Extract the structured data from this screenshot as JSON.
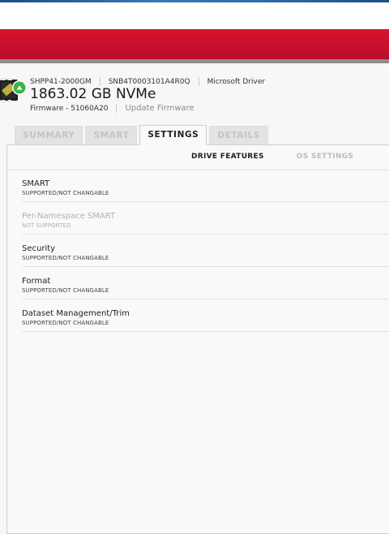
{
  "colors": {
    "accent_red": "#c8102e",
    "tab_active_text": "#222222",
    "tab_inactive_text": "#c4c4c4"
  },
  "drive": {
    "model": "SHPP41-2000GM",
    "serial": "SNB4T0003101A4R0Q",
    "driver": "Microsoft Driver",
    "capacity": "1863.02 GB NVMe",
    "firmware": "Firmware - 51060A20",
    "update_firmware": "Update Firmware",
    "icon": "ssd-drive-icon"
  },
  "tabs": [
    {
      "label": "SUMMARY",
      "active": false
    },
    {
      "label": "SMART",
      "active": false
    },
    {
      "label": "SETTINGS",
      "active": true
    },
    {
      "label": "DETAILS",
      "active": false
    }
  ],
  "subtabs": [
    {
      "label": "DRIVE FEATURES",
      "active": true
    },
    {
      "label": "OS SETTINGS",
      "active": false
    }
  ],
  "features": [
    {
      "name": "SMART",
      "status": "SUPPORTED/NOT CHANGABLE",
      "enabled": true
    },
    {
      "name": "Per-Namespace SMART",
      "status": "NOT SUPPORTED",
      "enabled": false
    },
    {
      "name": "Security",
      "status": "SUPPORTED/NOT CHANGABLE",
      "enabled": true
    },
    {
      "name": "Format",
      "status": "SUPPORTED/NOT CHANGABLE",
      "enabled": true
    },
    {
      "name": "Dataset Management/Trim",
      "status": "SUPPORTED/NOT CHANGABLE",
      "enabled": true
    }
  ]
}
